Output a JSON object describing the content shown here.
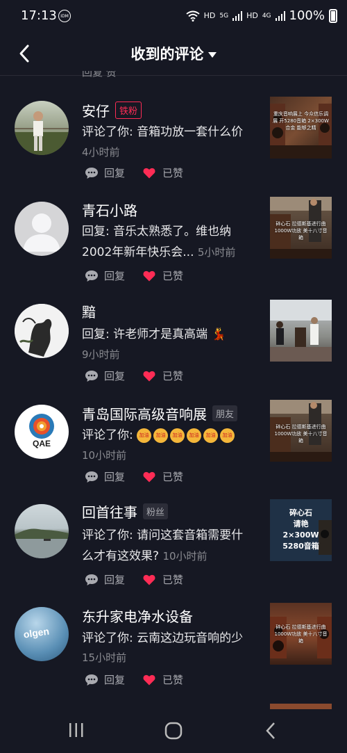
{
  "status_bar": {
    "time": "17:13",
    "idm": "IDM",
    "hd1": "HD",
    "hd2": "HD",
    "net1": "5G",
    "net2": "4G",
    "battery": "100%"
  },
  "header": {
    "title": "收到的评论"
  },
  "peek_text": "回复            赞",
  "comments": [
    {
      "name": "安仔",
      "tag": "铁粉",
      "tag_style": "red",
      "content": "评论了你: 音箱功放一套什么价",
      "time": "4小时前",
      "reply_label": "回复",
      "liked_label": "已赞",
      "thumb_caption": "重庆音响展上 今众信乐调展 开5280音箱 2×300W合金 能够之精"
    },
    {
      "name": "青石小路",
      "tag": "",
      "content_line1": "回复: 音乐太熟悉了。维也纳",
      "content_line2": "2002年新年快乐会...",
      "time": "5小时前",
      "reply_label": "回复",
      "liked_label": "已赞",
      "thumb_caption": "碎心石 拉德斯基进行曲 1000W功放 美十八寸音箱"
    },
    {
      "name": "黯",
      "tag": "",
      "content": "回复: 许老师才是真高端",
      "emoji": "💃",
      "time": "9小时前",
      "reply_label": "回复",
      "liked_label": "已赞"
    },
    {
      "name": "青岛国际高级音响展",
      "tag": "朋友",
      "tag_style": "gray",
      "content": "评论了你:",
      "emoji": "加油",
      "time": "10小时前",
      "reply_label": "回复",
      "liked_label": "已赞",
      "thumb_caption": "碎心石 拉德斯基进行曲 1000W功放 美十八寸音箱"
    },
    {
      "name": "回首往事",
      "tag": "粉丝",
      "tag_style": "gray",
      "content_line1": "评论了你: 请问这套音箱需要什",
      "content_line2": "么才有这效果?",
      "time": "10小时前",
      "reply_label": "回复",
      "liked_label": "已赞",
      "thumb_caption_lines": [
        "碎心石",
        "请艳",
        "2×300W",
        "5280音箱"
      ]
    },
    {
      "name": "东升家电净水设备",
      "tag": "",
      "content": "评论了你: 云南这边玩音响的少",
      "time": "15小时前",
      "reply_label": "回复",
      "liked_label": "已赞",
      "thumb_caption": "碎心石 拉德斯基进行曲 1000W功放 美十八寸音箱",
      "avatar_text": "olgen"
    }
  ],
  "colors": {
    "background": "#161823",
    "accent_red": "#fe2c55",
    "secondary_text": "#8a8b91"
  }
}
